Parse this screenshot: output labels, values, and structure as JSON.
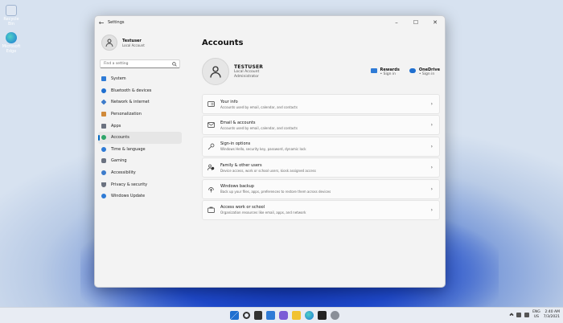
{
  "desktop": {
    "icons": [
      {
        "label": "Recycle Bin",
        "icon": "recycle-bin-icon"
      },
      {
        "label": "Microsoft Edge",
        "icon": "edge-icon"
      }
    ]
  },
  "window": {
    "title": "Settings",
    "controls": [
      "–",
      "☐",
      "✕"
    ]
  },
  "sidebar": {
    "user_name": "Testuser",
    "user_type": "Local Account",
    "search_placeholder": "Find a setting",
    "items": [
      {
        "label": "System",
        "icon": "system-icon",
        "color": "#2f7bd6"
      },
      {
        "label": "Bluetooth & devices",
        "icon": "bluetooth-icon",
        "color": "#1f6fd0"
      },
      {
        "label": "Network & internet",
        "icon": "network-icon",
        "color": "#3d7ccb"
      },
      {
        "label": "Personalization",
        "icon": "brush-icon",
        "color": "#d08a3a"
      },
      {
        "label": "Apps",
        "icon": "apps-icon",
        "color": "#6b7280"
      },
      {
        "label": "Accounts",
        "icon": "accounts-icon",
        "color": "#2fa56a",
        "active": true
      },
      {
        "label": "Time & language",
        "icon": "globe-icon",
        "color": "#2f7bd6"
      },
      {
        "label": "Gaming",
        "icon": "gaming-icon",
        "color": "#6b7280"
      },
      {
        "label": "Accessibility",
        "icon": "accessibility-icon",
        "color": "#3d7ccb"
      },
      {
        "label": "Privacy & security",
        "icon": "shield-icon",
        "color": "#6b7280"
      },
      {
        "label": "Windows Update",
        "icon": "update-icon",
        "color": "#2f7bd6"
      }
    ]
  },
  "main": {
    "title": "Accounts",
    "user_name": "TESTUSER",
    "account_type": "Local Account",
    "role": "Administrator",
    "rewards": {
      "title": "Rewards",
      "sub": "• Sign in"
    },
    "onedrive": {
      "title": "OneDrive",
      "sub": "• Sign in"
    },
    "cards": [
      {
        "title": "Your info",
        "desc": "Accounts used by email, calendar, and contacts",
        "icon": "id-card-icon"
      },
      {
        "title": "Email & accounts",
        "desc": "Accounts used by email, calendar, and contacts",
        "icon": "mail-icon"
      },
      {
        "title": "Sign-in options",
        "desc": "Windows Hello, security key, password, dynamic lock",
        "icon": "key-icon"
      },
      {
        "title": "Family & other users",
        "desc": "Device access, work or school users, kiosk assigned access",
        "icon": "family-icon"
      },
      {
        "title": "Windows backup",
        "desc": "Back up your files, apps, preferences to restore them across devices",
        "icon": "backup-icon"
      },
      {
        "title": "Access work or school",
        "desc": "Organization resources like email, apps, and network",
        "icon": "briefcase-icon"
      }
    ]
  },
  "taskbar": {
    "lang_top": "ENG",
    "lang_bottom": "US",
    "time": "2:40 AM",
    "date": "7/3/2021"
  },
  "colors": {
    "accent": "#0067c0"
  }
}
